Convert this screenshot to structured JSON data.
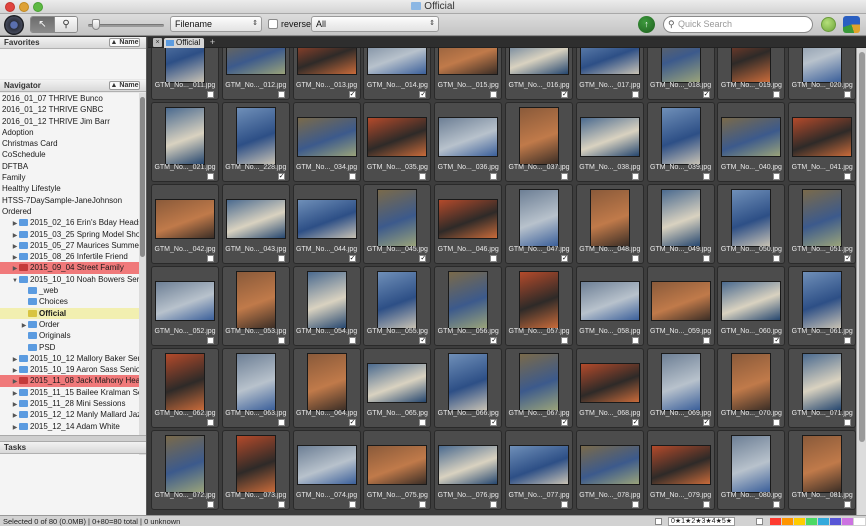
{
  "window": {
    "title": "Official"
  },
  "toolbar": {
    "sort_select": "Filename",
    "reverse_label": "reverse",
    "filter_select": "All",
    "search_placeholder": "Quick Search"
  },
  "favorites": {
    "title": "Favorites",
    "sort_button": "Name"
  },
  "navigator": {
    "title": "Navigator",
    "sort_button": "Name",
    "items": [
      {
        "label": "2016_01_07 THRIVE Bunco",
        "indent": 0,
        "tri": "",
        "highlight": "",
        "folder": ""
      },
      {
        "label": "2016_01_12 THRIVE GNBC",
        "indent": 0,
        "tri": "",
        "highlight": "",
        "folder": ""
      },
      {
        "label": "2016_01_12 THRIVE Jim Barr",
        "indent": 0,
        "tri": "",
        "highlight": "",
        "folder": ""
      },
      {
        "label": "Adoption",
        "indent": 0,
        "tri": "",
        "highlight": "",
        "folder": ""
      },
      {
        "label": "Christmas Card",
        "indent": 0,
        "tri": "",
        "highlight": "",
        "folder": ""
      },
      {
        "label": "CoSchedule",
        "indent": 0,
        "tri": "",
        "highlight": "",
        "folder": ""
      },
      {
        "label": "DFTBA",
        "indent": 0,
        "tri": "",
        "highlight": "",
        "folder": ""
      },
      {
        "label": "Family",
        "indent": 0,
        "tri": "",
        "highlight": "",
        "folder": ""
      },
      {
        "label": "Healthy Lifestyle",
        "indent": 0,
        "tri": "",
        "highlight": "",
        "folder": ""
      },
      {
        "label": "HTSS-7DaySample-JaneJohnson",
        "indent": 0,
        "tri": "",
        "highlight": "",
        "folder": ""
      },
      {
        "label": "Ordered",
        "indent": 0,
        "tri": "",
        "highlight": "",
        "folder": ""
      },
      {
        "label": "2015_02_16 Erin's Bday Headshots",
        "indent": 1,
        "tri": "▶",
        "highlight": "",
        "folder": "blue"
      },
      {
        "label": "2015_03_25 Spring Model Shoot",
        "indent": 1,
        "tri": "▶",
        "highlight": "",
        "folder": "blue"
      },
      {
        "label": "2015_05_27 Maurices Summer M",
        "indent": 1,
        "tri": "▶",
        "highlight": "",
        "folder": "blue"
      },
      {
        "label": "2015_08_26 Infertile Friend",
        "indent": 1,
        "tri": "▶",
        "highlight": "",
        "folder": "blue"
      },
      {
        "label": "2015_09_04 Street Family",
        "indent": 1,
        "tri": "▶",
        "highlight": "red",
        "folder": "red"
      },
      {
        "label": "2015_10_10 Noah Bowers Senior",
        "indent": 1,
        "tri": "▼",
        "highlight": "",
        "folder": "blue"
      },
      {
        "label": "_web",
        "indent": 2,
        "tri": "",
        "highlight": "",
        "folder": "blue"
      },
      {
        "label": "Choices",
        "indent": 2,
        "tri": "",
        "highlight": "",
        "folder": "blue"
      },
      {
        "label": "Official",
        "indent": 2,
        "tri": "",
        "highlight": "yellow",
        "folder": "blue"
      },
      {
        "label": "Order",
        "indent": 2,
        "tri": "▶",
        "highlight": "",
        "folder": "blue"
      },
      {
        "label": "Originals",
        "indent": 2,
        "tri": "",
        "highlight": "",
        "folder": "blue"
      },
      {
        "label": "PSD",
        "indent": 2,
        "tri": "",
        "highlight": "",
        "folder": "blue"
      },
      {
        "label": "2015_10_12 Mallory Baker Senior",
        "indent": 1,
        "tri": "▶",
        "highlight": "",
        "folder": "blue"
      },
      {
        "label": "2015_10_19 Aaron Sass Senior",
        "indent": 1,
        "tri": "▶",
        "highlight": "",
        "folder": "blue"
      },
      {
        "label": "2015_11_08 Jack Mahony Head",
        "indent": 1,
        "tri": "▶",
        "highlight": "red",
        "folder": "red"
      },
      {
        "label": "2015_11_15 Bailee Kralman Senior",
        "indent": 1,
        "tri": "▶",
        "highlight": "",
        "folder": "blue"
      },
      {
        "label": "2015_11_28 Mini Sessions",
        "indent": 1,
        "tri": "▶",
        "highlight": "",
        "folder": "blue"
      },
      {
        "label": "2015_12_12 Manly Mallard Jazz",
        "indent": 1,
        "tri": "▶",
        "highlight": "",
        "folder": "blue"
      },
      {
        "label": "2015_12_14 Adam White",
        "indent": 1,
        "tri": "▶",
        "highlight": "",
        "folder": "blue"
      }
    ]
  },
  "tasks": {
    "title": "Tasks"
  },
  "tabs": {
    "active": "Official",
    "add": "+",
    "close": "×"
  },
  "thumbnails": [
    {
      "label": "GTM_No..._011.jpg",
      "checked": false,
      "kind": "portrait"
    },
    {
      "label": "GTM_No..._012.jpg",
      "checked": false,
      "kind": "landscape"
    },
    {
      "label": "GTM_No..._013.jpg",
      "checked": true,
      "kind": "landscape"
    },
    {
      "label": "GTM_No..._014.jpg",
      "checked": true,
      "kind": "landscape"
    },
    {
      "label": "GTM_No..._015.jpg",
      "checked": false,
      "kind": "landscape"
    },
    {
      "label": "GTM_No..._016.jpg",
      "checked": true,
      "kind": "landscape"
    },
    {
      "label": "GTM_No..._017.jpg",
      "checked": false,
      "kind": "landscape"
    },
    {
      "label": "GTM_No..._018.jpg",
      "checked": true,
      "kind": "portrait"
    },
    {
      "label": "GTM_No..._019.jpg",
      "checked": false,
      "kind": "portrait"
    },
    {
      "label": "GTM_No..._020.jpg",
      "checked": false,
      "kind": "portrait"
    },
    {
      "label": "GTM_No..._021.jpg",
      "checked": false,
      "kind": "portrait"
    },
    {
      "label": "GTM_No..._228.jpg",
      "checked": true,
      "kind": "portrait"
    },
    {
      "label": "GTM_No..._034.jpg",
      "checked": false,
      "kind": "landscape"
    },
    {
      "label": "GTM_No..._035.jpg",
      "checked": false,
      "kind": "landscape"
    },
    {
      "label": "GTM_No..._036.jpg",
      "checked": false,
      "kind": "landscape"
    },
    {
      "label": "GTM_No..._037.jpg",
      "checked": false,
      "kind": "portrait"
    },
    {
      "label": "GTM_No..._038.jpg",
      "checked": false,
      "kind": "landscape"
    },
    {
      "label": "GTM_No..._039.jpg",
      "checked": false,
      "kind": "portrait"
    },
    {
      "label": "GTM_No..._040.jpg",
      "checked": false,
      "kind": "landscape"
    },
    {
      "label": "GTM_No..._041.jpg",
      "checked": false,
      "kind": "landscape"
    },
    {
      "label": "GTM_No..._042.jpg",
      "checked": false,
      "kind": "landscape"
    },
    {
      "label": "GTM_No..._043.jpg",
      "checked": false,
      "kind": "landscape"
    },
    {
      "label": "GTM_No..._044.jpg",
      "checked": true,
      "kind": "landscape"
    },
    {
      "label": "GTM_No..._045.jpg",
      "checked": true,
      "kind": "portrait"
    },
    {
      "label": "GTM_No..._046.jpg",
      "checked": false,
      "kind": "landscape"
    },
    {
      "label": "GTM_No..._047.jpg",
      "checked": true,
      "kind": "portrait"
    },
    {
      "label": "GTM_No..._048.jpg",
      "checked": false,
      "kind": "portrait"
    },
    {
      "label": "GTM_No..._049.jpg",
      "checked": false,
      "kind": "portrait"
    },
    {
      "label": "GTM_No..._050.jpg",
      "checked": false,
      "kind": "portrait"
    },
    {
      "label": "GTM_No..._051.jpg",
      "checked": true,
      "kind": "portrait"
    },
    {
      "label": "GTM_No..._052.jpg",
      "checked": false,
      "kind": "landscape"
    },
    {
      "label": "GTM_No..._053.jpg",
      "checked": false,
      "kind": "portrait"
    },
    {
      "label": "GTM_No..._054.jpg",
      "checked": false,
      "kind": "portrait"
    },
    {
      "label": "GTM_No..._055.jpg",
      "checked": true,
      "kind": "portrait"
    },
    {
      "label": "GTM_No..._056.jpg",
      "checked": true,
      "kind": "portrait"
    },
    {
      "label": "GTM_No..._057.jpg",
      "checked": false,
      "kind": "portrait"
    },
    {
      "label": "GTM_No..._058.jpg",
      "checked": false,
      "kind": "landscape"
    },
    {
      "label": "GTM_No..._059.jpg",
      "checked": false,
      "kind": "landscape"
    },
    {
      "label": "GTM_No..._060.jpg",
      "checked": true,
      "kind": "landscape"
    },
    {
      "label": "GTM_No..._061.jpg",
      "checked": false,
      "kind": "portrait"
    },
    {
      "label": "GTM_No..._062.jpg",
      "checked": false,
      "kind": "portrait"
    },
    {
      "label": "GTM_No..._063.jpg",
      "checked": false,
      "kind": "portrait"
    },
    {
      "label": "GTM_No..._064.jpg",
      "checked": true,
      "kind": "portrait"
    },
    {
      "label": "GTM_No..._065.jpg",
      "checked": false,
      "kind": "landscape"
    },
    {
      "label": "GTM_No..._066.jpg",
      "checked": true,
      "kind": "portrait"
    },
    {
      "label": "GTM_No..._067.jpg",
      "checked": true,
      "kind": "portrait"
    },
    {
      "label": "GTM_No..._068.jpg",
      "checked": true,
      "kind": "landscape"
    },
    {
      "label": "GTM_No..._069.jpg",
      "checked": true,
      "kind": "portrait"
    },
    {
      "label": "GTM_No..._070.jpg",
      "checked": false,
      "kind": "portrait"
    },
    {
      "label": "GTM_No..._071.jpg",
      "checked": false,
      "kind": "portrait"
    },
    {
      "label": "GTM_No..._072.jpg",
      "checked": false,
      "kind": "portrait"
    },
    {
      "label": "GTM_No..._073.jpg",
      "checked": false,
      "kind": "portrait"
    },
    {
      "label": "GTM_No..._074.jpg",
      "checked": false,
      "kind": "landscape"
    },
    {
      "label": "GTM_No..._075.jpg",
      "checked": false,
      "kind": "landscape"
    },
    {
      "label": "GTM_No..._076.jpg",
      "checked": false,
      "kind": "landscape"
    },
    {
      "label": "GTM_No..._077.jpg",
      "checked": false,
      "kind": "landscape"
    },
    {
      "label": "GTM_No..._078.jpg",
      "checked": false,
      "kind": "landscape"
    },
    {
      "label": "GTM_No..._079.jpg",
      "checked": false,
      "kind": "landscape"
    },
    {
      "label": "GTM_No..._080.jpg",
      "checked": false,
      "kind": "portrait"
    },
    {
      "label": "GTM_No..._081.jpg",
      "checked": false,
      "kind": "portrait"
    }
  ],
  "status": {
    "text": "Selected 0 of 80 (0.0MB) | 0+80=80 total | 0 unknown",
    "rating": "0★1★2★3★4★5★"
  },
  "label_colors": [
    "#ff3b30",
    "#ff9500",
    "#ffcc00",
    "#4cd964",
    "#34aadc",
    "#5856d6",
    "#cc73e1",
    "#ffffff"
  ]
}
